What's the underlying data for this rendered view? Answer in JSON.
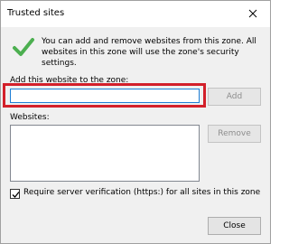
{
  "window": {
    "title": "Trusted sites",
    "close_icon": "close-icon"
  },
  "intro": {
    "icon": "checkmark-icon",
    "text": "You can add and remove websites from this zone. All websites in this zone will use the zone's security settings."
  },
  "add_section": {
    "label": "Add this website to the zone:",
    "input_value": "",
    "add_button_label": "Add",
    "highlight_color": "#d3202a"
  },
  "websites_section": {
    "label": "Websites:",
    "items": [],
    "remove_button_label": "Remove"
  },
  "verification": {
    "checked": true,
    "label": "Require server verification (https:) for all sites in this zone"
  },
  "footer": {
    "close_button_label": "Close"
  },
  "colors": {
    "accent": "#1e7fd6",
    "check_green": "#4caf50",
    "dialog_bg": "#f0f0f0"
  }
}
